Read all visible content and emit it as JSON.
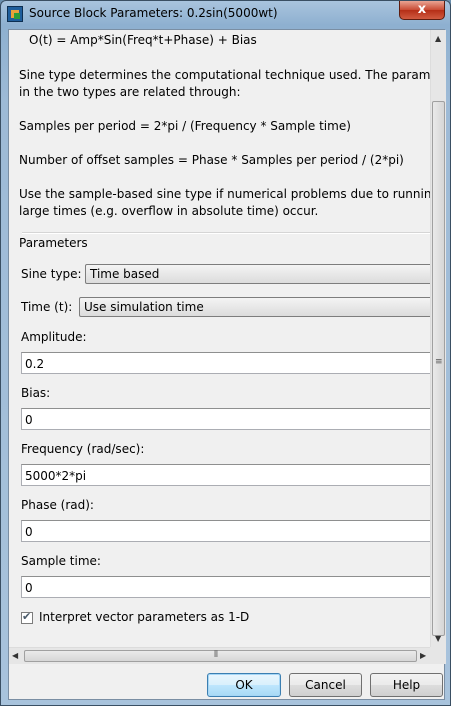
{
  "window": {
    "title": "Source Block Parameters: 0.2sin(5000wt)",
    "close_label": "x"
  },
  "description": {
    "formula": "O(t) = Amp*Sin(Freq*t+Phase) + Bias",
    "para1_line1": "Sine type determines the computational technique used. The parameter",
    "para1_line2": "in the two types are related through:",
    "para2": "Samples per period = 2*pi / (Frequency * Sample time)",
    "para3": "Number of offset samples = Phase * Samples per period / (2*pi)",
    "para4_line1": "Use the sample-based sine type if numerical problems due to running fo",
    "para4_line2": "large times (e.g. overflow in absolute time) occur."
  },
  "parameters": {
    "group_label": "Parameters",
    "sine_type": {
      "label": "Sine type:",
      "value": "Time based"
    },
    "time": {
      "label": "Time (t):",
      "value": "Use simulation time"
    },
    "amplitude": {
      "label": "Amplitude:",
      "value": "0.2"
    },
    "bias": {
      "label": "Bias:",
      "value": "0"
    },
    "frequency": {
      "label": "Frequency (rad/sec):",
      "value": "5000*2*pi"
    },
    "phase": {
      "label": "Phase (rad):",
      "value": "0"
    },
    "sample_time": {
      "label": "Sample time:",
      "value": "0"
    },
    "interpret_vector": {
      "label": "Interpret vector parameters as 1-D",
      "checked": true
    }
  },
  "buttons": {
    "ok": "OK",
    "cancel": "Cancel",
    "help": "Help"
  }
}
